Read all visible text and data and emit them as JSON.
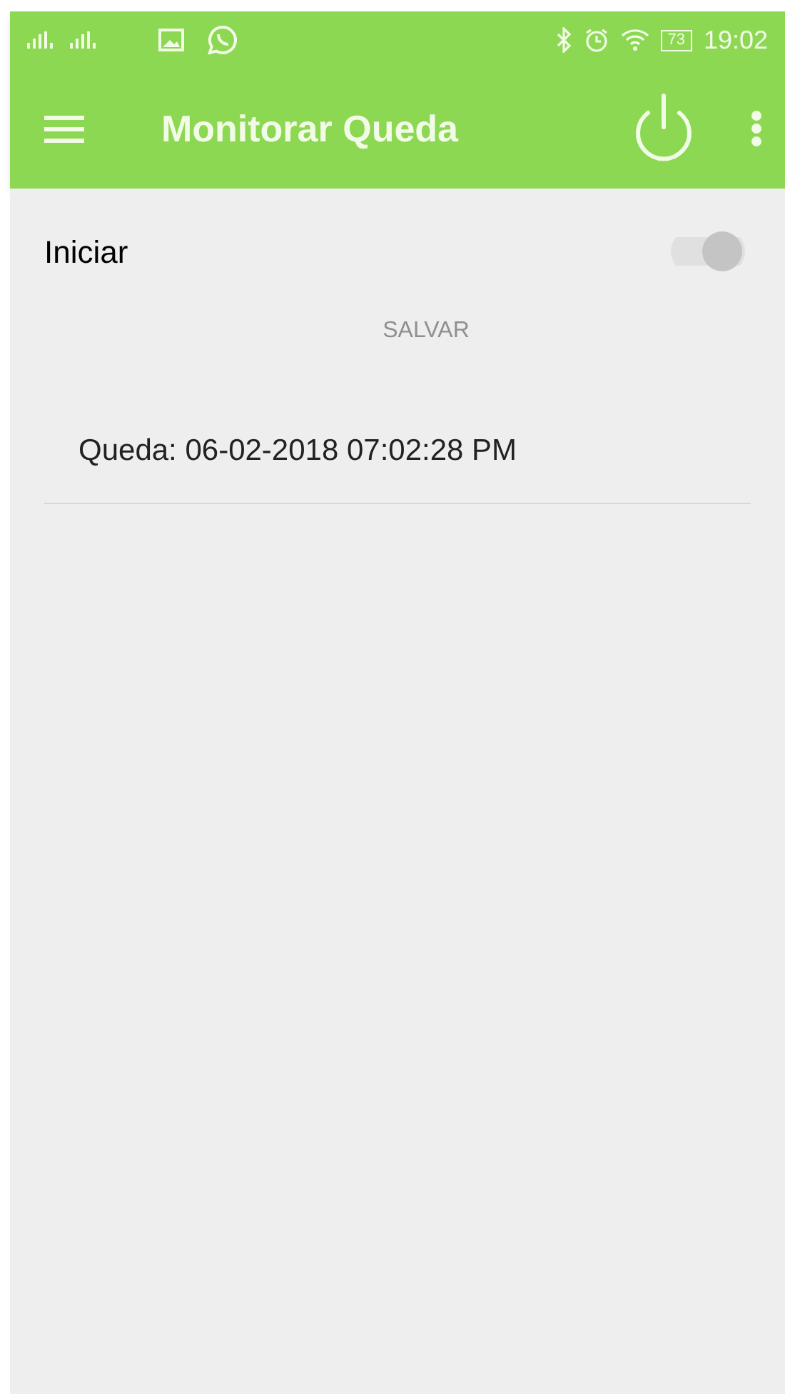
{
  "status_bar": {
    "battery": "73",
    "time": "19:02"
  },
  "toolbar": {
    "title": "Monitorar Queda"
  },
  "switch_row": {
    "label": "Iniciar",
    "on": true,
    "disabled": true
  },
  "save_button": {
    "label": "SALVAR",
    "disabled": true
  },
  "falls": [
    {
      "text": "Queda: 06-02-2018 07:02:28 PM"
    }
  ]
}
